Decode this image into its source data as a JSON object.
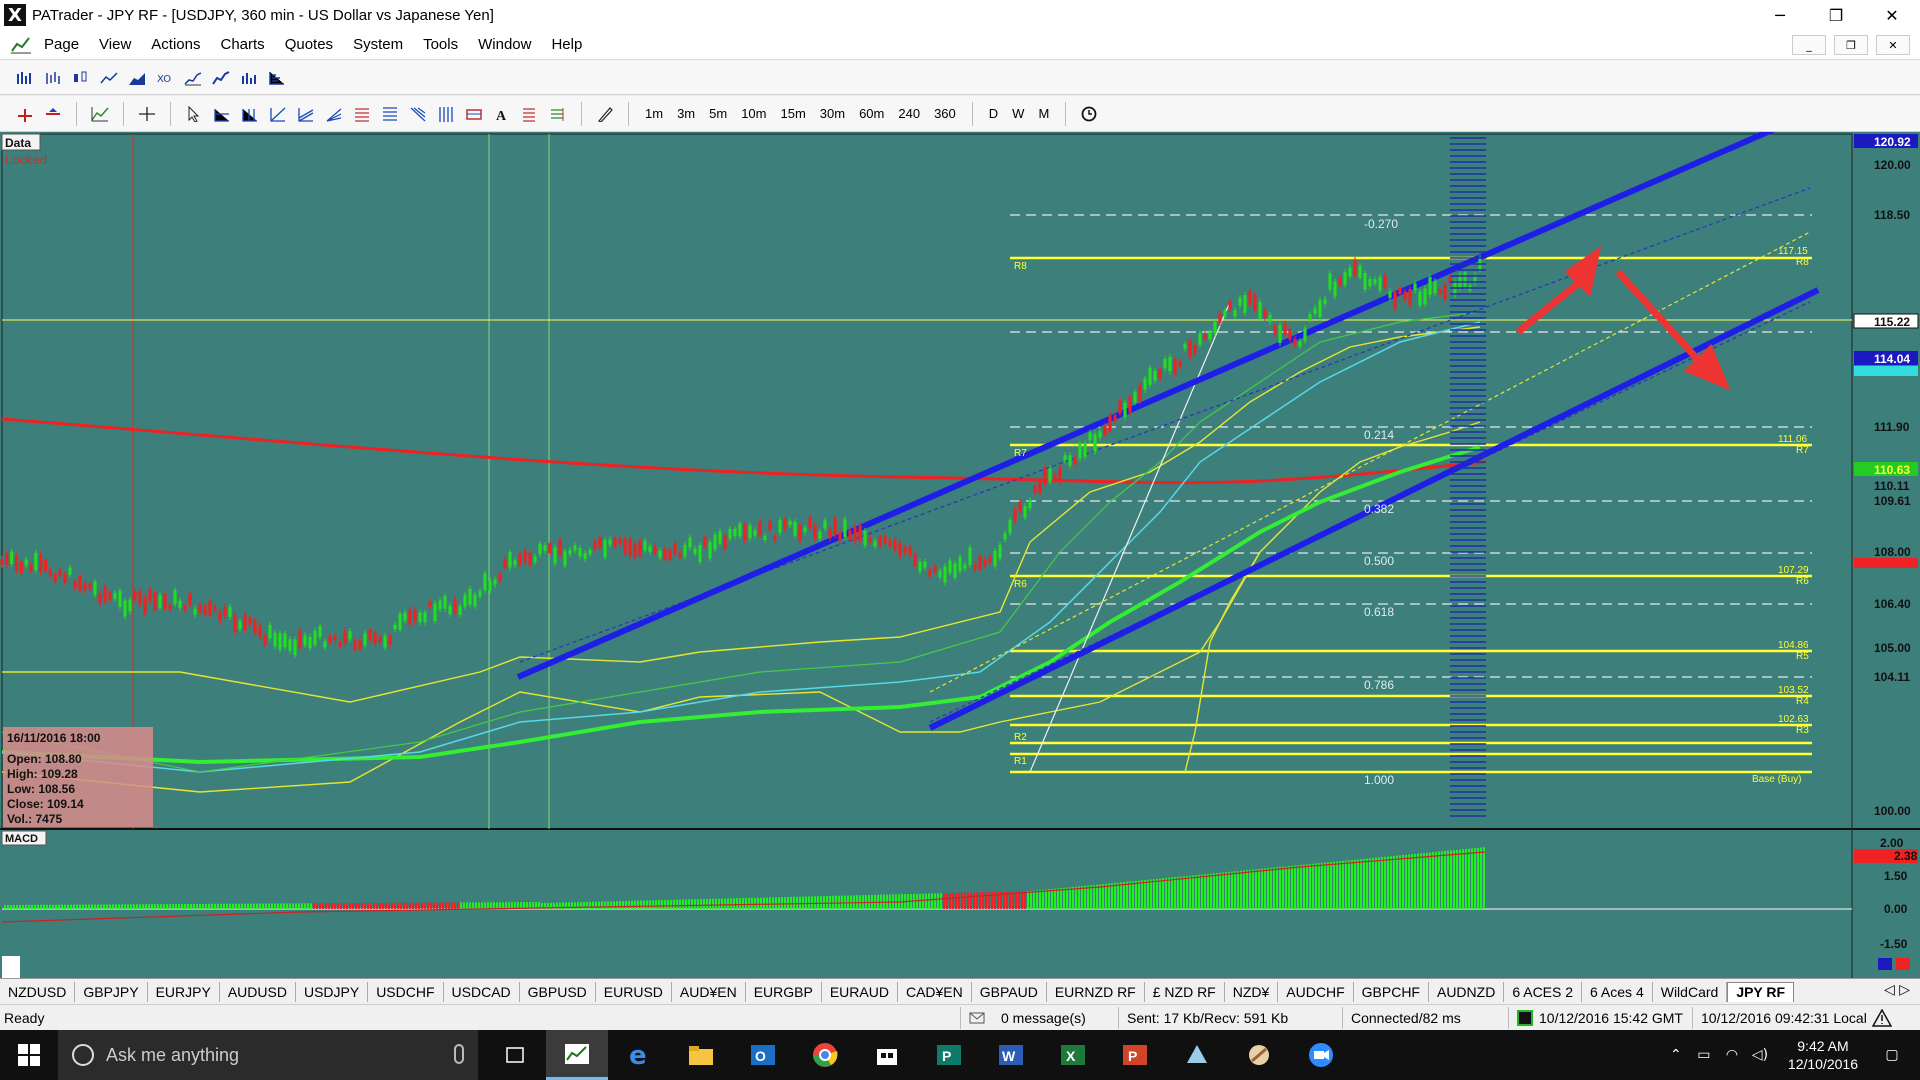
{
  "window": {
    "title": "PATrader - JPY RF - [USDJPY, 360 min - US Dollar vs Japanese Yen]",
    "controls": {
      "minimize": "─",
      "restore": "❐",
      "close": "✕"
    }
  },
  "menu": {
    "items": [
      "Page",
      "View",
      "Actions",
      "Charts",
      "Quotes",
      "System",
      "Tools",
      "Window",
      "Help"
    ],
    "mdi": {
      "minimize": "_",
      "restore": "❐",
      "close": "✕"
    }
  },
  "toolbar": {
    "timeframes": [
      "1m",
      "3m",
      "5m",
      "10m",
      "15m",
      "30m",
      "60m",
      "240",
      "360"
    ],
    "periods": [
      "D",
      "W",
      "M"
    ]
  },
  "chart": {
    "data_label": "Data",
    "locked_label": "Locked",
    "macd_label": "MACD",
    "info_box": {
      "date": "16/11/2016 18:00",
      "open": "Open: 108.80",
      "high": "High: 109.28",
      "low": "Low: 108.56",
      "close": "Close: 109.14",
      "vol": "Vol.: 7475"
    },
    "price_labels": [
      "120.92",
      "120.00",
      "118.50",
      "115.22",
      "114.04",
      "111.90",
      "110.63",
      "110.11",
      "109.61",
      "108.00",
      "106.40",
      "105.00",
      "104.11",
      "100.00"
    ],
    "macd_labels": [
      "2.00",
      "1.50",
      "0.00",
      "-1.50"
    ],
    "macd_value": "2.38",
    "fib_levels": [
      "-0.270",
      "0.214",
      "0.382",
      "0.500",
      "0.618",
      "0.786",
      "1.000"
    ],
    "pivot_left": [
      "R8",
      "R7",
      "R6",
      "R2",
      "R1"
    ],
    "pivot_right": [
      "117.15",
      "R8",
      "111.06",
      "R7",
      "107.29",
      "R6",
      "104.86",
      "R5",
      "103.52",
      "R4",
      "102.63",
      "R3",
      "Base (Buy)"
    ],
    "colors": {
      "background": "#3d7f7b",
      "channel": "#1e1ee6",
      "pivot": "#ffff33",
      "up": "#22dd22",
      "down": "#ee2222",
      "arrow": "#ee3333"
    }
  },
  "symbol_tabs": [
    "NZDUSD",
    "GBPJPY",
    "EURJPY",
    "AUDUSD",
    "USDJPY",
    "USDCHF",
    "USDCAD",
    "GBPUSD",
    "EURUSD",
    "AUD¥EN",
    "EURGBP",
    "EURAUD",
    "CAD¥EN",
    "GBPAUD",
    "EURNZD RF",
    "£ NZD RF",
    "NZD¥",
    "AUDCHF",
    "GBPCHF",
    "AUDNZD",
    "6 ACES 2",
    "6 Aces 4",
    "WildCard",
    "JPY RF"
  ],
  "active_tab": "JPY RF",
  "status": {
    "ready": "Ready",
    "messages": "0 message(s)",
    "traffic": "Sent: 17 Kb/Recv: 591 Kb",
    "connection": "Connected/82 ms",
    "gmt": "10/12/2016 15:42 GMT",
    "local": "10/12/2016 09:42:31 Local"
  },
  "taskbar": {
    "search_placeholder": "Ask me anything",
    "time": "9:42 AM",
    "date": "12/10/2016"
  }
}
